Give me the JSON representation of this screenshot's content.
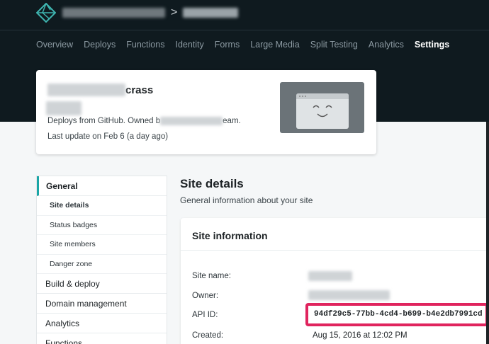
{
  "header": {
    "logo_icon": "netlify-logo-icon",
    "crumb_separator": ">"
  },
  "nav": {
    "items": [
      {
        "label": "Overview"
      },
      {
        "label": "Deploys"
      },
      {
        "label": "Functions"
      },
      {
        "label": "Identity"
      },
      {
        "label": "Forms"
      },
      {
        "label": "Large Media"
      },
      {
        "label": "Split Testing"
      },
      {
        "label": "Analytics"
      },
      {
        "label": "Settings"
      }
    ],
    "active": "Settings"
  },
  "site_card": {
    "title_suffix": "crass",
    "deploy_prefix": "Deploys from GitHub. Owned b",
    "deploy_suffix": "eam.",
    "last_update": "Last update on Feb 6 (a day ago)",
    "preview_icon": "smiley-browser-icon"
  },
  "sidebar": {
    "general": "General",
    "sub_items": [
      "Site details",
      "Status badges",
      "Site members",
      "Danger zone"
    ],
    "items": [
      "Build & deploy",
      "Domain management",
      "Analytics",
      "Functions"
    ]
  },
  "section": {
    "title": "Site details",
    "description": "General information about your site"
  },
  "site_info": {
    "title": "Site information",
    "site_name_label": "Site name:",
    "owner_label": "Owner:",
    "api_id_label": "API ID:",
    "api_id_value": "94df29c5-77bb-4cd4-b699-b4e2db7991cd",
    "created_label": "Created:",
    "created_value": "Aug 15, 2016 at 12:02 PM"
  },
  "colors": {
    "topbar": "#0f1a1f",
    "highlight": "#e0245e",
    "accent": "#1aa6a6"
  }
}
